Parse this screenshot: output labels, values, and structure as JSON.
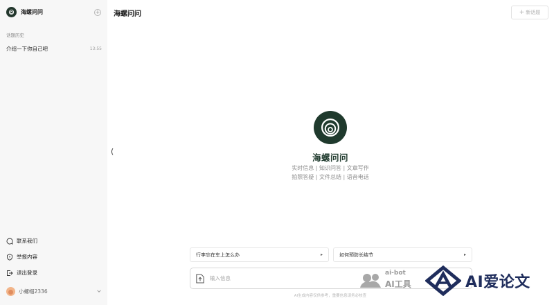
{
  "sidebar": {
    "brand_name": "海螺问问",
    "history_label": "话题历史",
    "history": [
      {
        "title": "介绍一下你自己吧",
        "time": "13:55"
      }
    ],
    "links": {
      "contact": "联系我们",
      "report": "举报内容",
      "logout": "退出登录"
    },
    "user": {
      "name": "小螺帽2336"
    }
  },
  "header": {
    "title": "海螺问问",
    "new_topic": "新话题"
  },
  "hero": {
    "name": "海螺问问",
    "line1": "实时信息 | 知识问答 | 文章写作",
    "line2": "拍照答疑 | 文件总结 | 语音电话"
  },
  "suggestions": [
    {
      "label": "行李忘在车上怎么办"
    },
    {
      "label": "如何预防长结节"
    }
  ],
  "input": {
    "placeholder": "输入信息"
  },
  "disclaimer": "AI生成内容仅供参考，重要信息请务必核查",
  "watermark": {
    "bot_name": "ai-bot",
    "bot_sub": "AI工具",
    "main": "AI爱论文"
  },
  "colors": {
    "brand_dark": "#1f3a2d",
    "sidebar_bg": "#f7f7f7",
    "watermark_navy": "#1f2d5c"
  }
}
